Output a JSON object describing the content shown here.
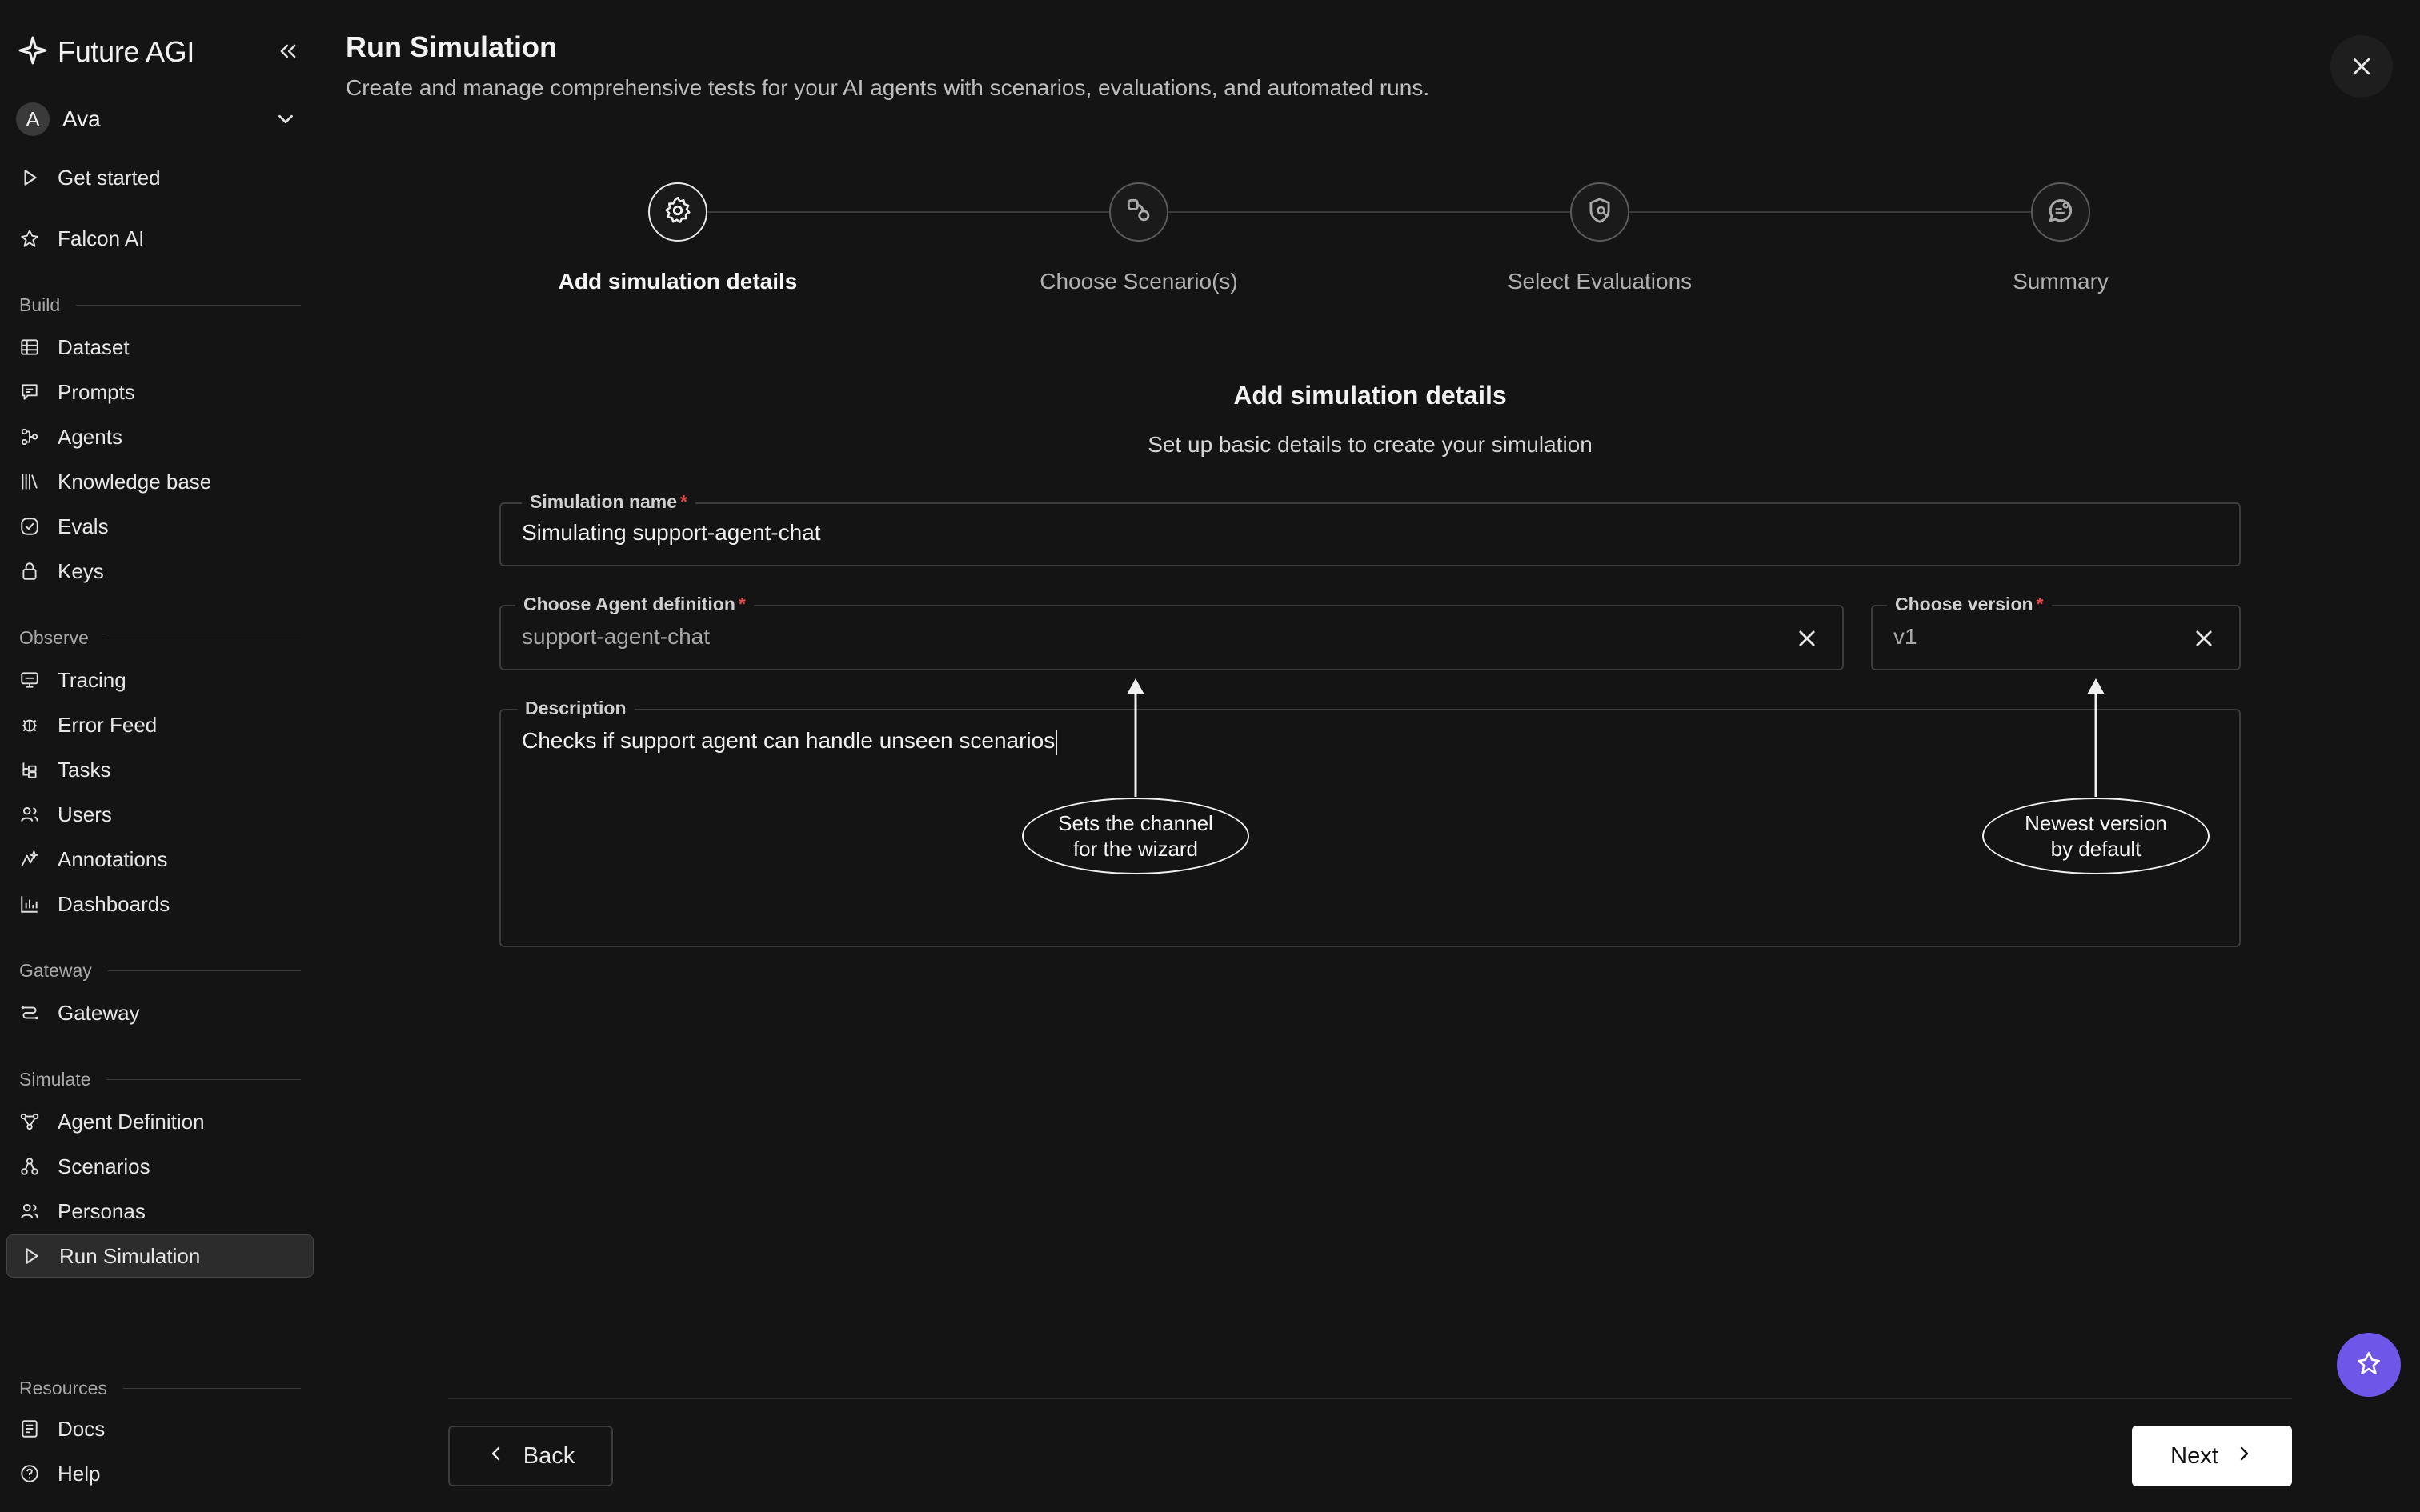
{
  "app": {
    "brand": "Future AGI",
    "workspace": {
      "initial": "A",
      "name": "Ava"
    }
  },
  "sidebar": {
    "top_items": [
      {
        "label": "Get started",
        "icon": "play-icon"
      },
      {
        "label": "Falcon AI",
        "icon": "falcon-icon"
      }
    ],
    "sections": [
      {
        "label": "Build",
        "items": [
          {
            "label": "Dataset",
            "icon": "table-icon"
          },
          {
            "label": "Prompts",
            "icon": "prompt-icon"
          },
          {
            "label": "Agents",
            "icon": "agents-icon"
          },
          {
            "label": "Knowledge base",
            "icon": "library-icon"
          },
          {
            "label": "Evals",
            "icon": "check-circle-icon"
          },
          {
            "label": "Keys",
            "icon": "lock-icon"
          }
        ]
      },
      {
        "label": "Observe",
        "items": [
          {
            "label": "Tracing",
            "icon": "tracing-icon"
          },
          {
            "label": "Error Feed",
            "icon": "bug-icon"
          },
          {
            "label": "Tasks",
            "icon": "tasks-icon"
          },
          {
            "label": "Users",
            "icon": "users-icon"
          },
          {
            "label": "Annotations",
            "icon": "annotation-icon"
          },
          {
            "label": "Dashboards",
            "icon": "chart-icon"
          }
        ]
      },
      {
        "label": "Gateway",
        "items": [
          {
            "label": "Gateway",
            "icon": "gateway-icon"
          }
        ]
      },
      {
        "label": "Simulate",
        "items": [
          {
            "label": "Agent Definition",
            "icon": "graph-icon"
          },
          {
            "label": "Scenarios",
            "icon": "scenarios-icon"
          },
          {
            "label": "Personas",
            "icon": "personas-icon"
          },
          {
            "label": "Run Simulation",
            "icon": "play-icon",
            "active": true
          }
        ]
      },
      {
        "label": "Resources",
        "items": [
          {
            "label": "Docs",
            "icon": "docs-icon"
          },
          {
            "label": "Help",
            "icon": "help-icon"
          }
        ]
      }
    ]
  },
  "header": {
    "title": "Run Simulation",
    "subtitle": "Create and manage comprehensive tests for your AI agents with scenarios, evaluations, and automated runs."
  },
  "steps": [
    {
      "label": "Add simulation details",
      "icon": "gear-icon",
      "active": true
    },
    {
      "label": "Choose Scenario(s)",
      "icon": "scenario-step-icon",
      "active": false
    },
    {
      "label": "Select Evaluations",
      "icon": "shield-search-icon",
      "active": false
    },
    {
      "label": "Summary",
      "icon": "summary-icon",
      "active": false
    }
  ],
  "form": {
    "title": "Add simulation details",
    "subtitle": "Set up basic details to create your simulation",
    "simulation_name": {
      "label": "Simulation name",
      "value": "Simulating support-agent-chat",
      "required": true
    },
    "agent_definition": {
      "label": "Choose Agent definition",
      "value": "support-agent-chat",
      "required": true
    },
    "version": {
      "label": "Choose version",
      "value": "v1",
      "required": true
    },
    "description": {
      "label": "Description",
      "value": "Checks if support agent can handle unseen scenarios"
    }
  },
  "callouts": {
    "agent": {
      "line1": "Sets the channel",
      "line2": "for the wizard"
    },
    "version": {
      "line1": "Newest version",
      "line2": "by default"
    }
  },
  "footer": {
    "back_label": "Back",
    "next_label": "Next"
  },
  "colors": {
    "accent_fab": "#6e56e8",
    "required_star": "#e5484d",
    "background": "#141414"
  }
}
